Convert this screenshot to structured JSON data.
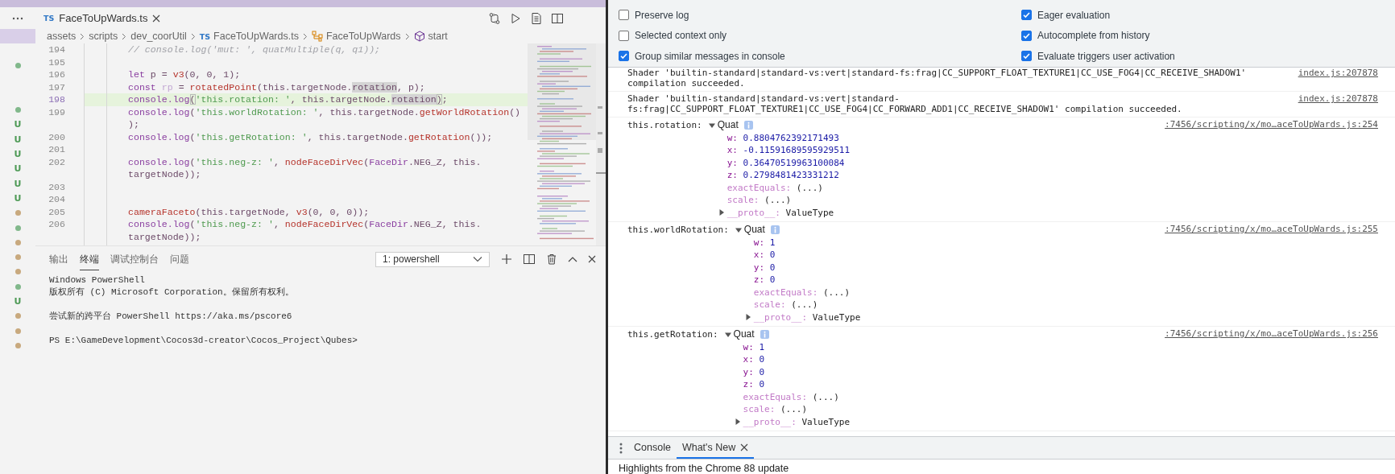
{
  "sidebar": {
    "items": [
      {
        "selected": true,
        "kind": "none"
      },
      {
        "selected": false,
        "kind": "none"
      },
      {
        "selected": false,
        "kind": "dot",
        "color": "#81b88b"
      },
      {
        "selected": false,
        "kind": "none"
      },
      {
        "selected": false,
        "kind": "none"
      },
      {
        "selected": false,
        "kind": "dot",
        "color": "#81b88b"
      },
      {
        "selected": false,
        "kind": "letter",
        "text": "U"
      },
      {
        "selected": false,
        "kind": "letter",
        "text": "U"
      },
      {
        "selected": false,
        "kind": "letter",
        "text": "U"
      },
      {
        "selected": false,
        "kind": "letter",
        "text": "U"
      },
      {
        "selected": false,
        "kind": "letter",
        "text": "U"
      },
      {
        "selected": false,
        "kind": "letter",
        "text": "U"
      },
      {
        "selected": false,
        "kind": "dot",
        "color": "#c8a97e"
      },
      {
        "selected": false,
        "kind": "dot",
        "color": "#81b88b"
      },
      {
        "selected": false,
        "kind": "dot",
        "color": "#c8a97e"
      },
      {
        "selected": false,
        "kind": "dot",
        "color": "#c8a97e"
      },
      {
        "selected": false,
        "kind": "dot",
        "color": "#c8a97e"
      },
      {
        "selected": false,
        "kind": "dot",
        "color": "#81b88b"
      },
      {
        "selected": false,
        "kind": "letter",
        "text": "U"
      },
      {
        "selected": false,
        "kind": "dot",
        "color": "#c8a97e"
      },
      {
        "selected": false,
        "kind": "dot",
        "color": "#c8a97e"
      },
      {
        "selected": false,
        "kind": "dot",
        "color": "#c8a97e"
      }
    ]
  },
  "editor": {
    "tabs": [
      {
        "badge": "TS",
        "label": "FaceToUpWards.ts",
        "selected": true
      }
    ],
    "breadcrumb": [
      {
        "kind": "folder",
        "label": "assets"
      },
      {
        "kind": "folder",
        "label": "scripts"
      },
      {
        "kind": "folder",
        "label": "dev_coorUtil"
      },
      {
        "kind": "file",
        "badge": "TS",
        "label": "FaceToUpWards.ts"
      },
      {
        "kind": "class",
        "label": "FaceToUpWards"
      },
      {
        "kind": "method",
        "label": "start"
      }
    ],
    "lines": [
      {
        "number": "194",
        "current": false,
        "tokens": [
          {
            "kind": "comment",
            "text": "// console.log('mut: ', quatMultiple(q, q1));"
          }
        ]
      },
      {
        "number": "195",
        "current": false
      },
      {
        "number": "196",
        "current": false,
        "tokens": [
          {
            "kind": "keyword",
            "text": "let"
          },
          {
            "kind": "plain",
            "text": " p = "
          },
          {
            "kind": "func",
            "text": "v3"
          },
          {
            "kind": "plain",
            "text": "(0, 0, 1);"
          }
        ]
      },
      {
        "number": "197",
        "current": false,
        "tokens": [
          {
            "kind": "keyword",
            "text": "const"
          },
          {
            "kind": "unused",
            "text": " rp"
          },
          {
            "kind": "plain",
            "text": " = "
          },
          {
            "kind": "func",
            "text": "rotatedPoint"
          },
          {
            "kind": "plain",
            "text": "(this.targetNode."
          },
          {
            "kind": "match",
            "text": "rotation"
          },
          {
            "kind": "plain",
            "text": ", p);"
          }
        ]
      },
      {
        "number": "198",
        "current": true,
        "tokens": [
          {
            "kind": "keyword",
            "text": "console.log"
          },
          {
            "kind": "bracket",
            "text": "("
          },
          {
            "kind": "string",
            "text": "'this.rotation: '"
          },
          {
            "kind": "plain",
            "text": ", this.targetNode."
          },
          {
            "kind": "match",
            "text": "rotation"
          },
          {
            "kind": "bracket",
            "text": ")"
          },
          {
            "kind": "plain",
            "text": ";"
          }
        ]
      },
      {
        "number": "199",
        "current": false,
        "tokens": [
          {
            "kind": "keyword",
            "text": "console.log"
          },
          {
            "kind": "plain",
            "text": "("
          },
          {
            "kind": "string",
            "text": "'this.worldRotation: '"
          },
          {
            "kind": "plain",
            "text": ", this.targetNode."
          },
          {
            "kind": "func",
            "text": "getWorldRotation"
          },
          {
            "kind": "plain",
            "text": "()"
          }
        ]
      },
      {
        "current": false,
        "tokens": [
          {
            "kind": "plain",
            "text": ");"
          }
        ]
      },
      {
        "number": "200",
        "current": false,
        "tokens": [
          {
            "kind": "keyword",
            "text": "console.log"
          },
          {
            "kind": "plain",
            "text": "("
          },
          {
            "kind": "string",
            "text": "'this.getRotation: '"
          },
          {
            "kind": "plain",
            "text": ", this.targetNode."
          },
          {
            "kind": "func",
            "text": "getRotation"
          },
          {
            "kind": "plain",
            "text": "());"
          }
        ]
      },
      {
        "number": "201",
        "current": false
      },
      {
        "number": "202",
        "current": false,
        "tokens": [
          {
            "kind": "keyword",
            "text": "console.log"
          },
          {
            "kind": "plain",
            "text": "("
          },
          {
            "kind": "string",
            "text": "'this.neg-z: '"
          },
          {
            "kind": "plain",
            "text": ", "
          },
          {
            "kind": "func",
            "text": "nodeFaceDirVec"
          },
          {
            "kind": "plain",
            "text": "("
          },
          {
            "kind": "keyword",
            "text": "FaceDir"
          },
          {
            "kind": "plain",
            "text": ".NEG_Z, this."
          }
        ]
      },
      {
        "current": false,
        "tokens": [
          {
            "kind": "plain",
            "text": "targetNode));"
          }
        ]
      },
      {
        "number": "203",
        "current": false
      },
      {
        "number": "204",
        "current": false
      },
      {
        "number": "205",
        "current": false,
        "tokens": [
          {
            "kind": "func",
            "text": "cameraFaceto"
          },
          {
            "kind": "plain",
            "text": "(this.targetNode, "
          },
          {
            "kind": "func",
            "text": "v3"
          },
          {
            "kind": "plain",
            "text": "(0, 0, 0));"
          }
        ]
      },
      {
        "number": "206",
        "current": false,
        "tokens": [
          {
            "kind": "keyword",
            "text": "console.log"
          },
          {
            "kind": "plain",
            "text": "("
          },
          {
            "kind": "string",
            "text": "'this.neg-z: '"
          },
          {
            "kind": "plain",
            "text": ", "
          },
          {
            "kind": "func",
            "text": "nodeFaceDirVec"
          },
          {
            "kind": "plain",
            "text": "("
          },
          {
            "kind": "keyword",
            "text": "FaceDir"
          },
          {
            "kind": "plain",
            "text": ".NEG_Z, this."
          }
        ]
      },
      {
        "current": false,
        "tokens": [
          {
            "kind": "plain",
            "text": "targetNode));"
          }
        ]
      }
    ]
  },
  "terminal": {
    "tabs": [
      {
        "label": "输出",
        "selected": false
      },
      {
        "label": "终端",
        "selected": true
      },
      {
        "label": "调试控制台",
        "selected": false
      },
      {
        "label": "问题",
        "selected": false
      }
    ],
    "dropdown": "1: powershell",
    "blocks": [
      {
        "lines": [
          "Windows PowerShell",
          "版权所有 (C) Microsoft Corporation。保留所有权利。"
        ]
      },
      {
        "lines": [
          "尝试新的跨平台 PowerShell https://aka.ms/pscore6"
        ]
      },
      {
        "lines": [
          "PS E:\\GameDevelopment\\Cocos3d-creator\\Cocos_Project\\Qubes>"
        ]
      }
    ]
  },
  "devtools": {
    "settings": [
      {
        "label": "Preserve log",
        "checked": false
      },
      {
        "label": "Eager evaluation",
        "checked": true
      },
      {
        "label": "Selected context only",
        "checked": false
      },
      {
        "label": "Autocomplete from history",
        "checked": true
      },
      {
        "label": "Group similar messages in console",
        "checked": true
      },
      {
        "label": "Evaluate triggers user activation",
        "checked": true
      }
    ],
    "messages": [
      {
        "kind": "text",
        "text": "Shader 'builtin-standard|standard-vs:vert|standard-fs:frag|CC_SUPPORT_FLOAT_TEXTURE1|CC_USE_FOG4|CC_RECEIVE_SHADOW1' compilation succeeded.",
        "source": "index.js:207878"
      },
      {
        "kind": "text",
        "text": "Shader 'builtin-standard|standard-vs:vert|standard-fs:frag|CC_SUPPORT_FLOAT_TEXTURE1|CC_USE_FOG4|CC_FORWARD_ADD1|CC_RECEIVE_SHADOW1' compilation succeeded.",
        "source": "index.js:207878"
      },
      {
        "kind": "object",
        "label": "this.rotation:",
        "type": "Quat",
        "expanded": true,
        "source": ":7456/scripting/x/mo…aceToUpWards.js:254",
        "properties": [
          {
            "kind": "own",
            "name": "w:",
            "value": "0.8804762392171493"
          },
          {
            "kind": "own",
            "name": "x:",
            "value": "-0.11591689595929511"
          },
          {
            "kind": "own",
            "name": "y:",
            "value": "0.36470519963100084"
          },
          {
            "kind": "own",
            "name": "z:",
            "value": "0.2798481423331212"
          },
          {
            "kind": "accessor",
            "name": "exactEquals:",
            "value": "(...)"
          },
          {
            "kind": "accessor",
            "name": "scale:",
            "value": "(...)"
          },
          {
            "kind": "proto",
            "name": "__proto__:",
            "value": "ValueType",
            "expanded": false
          }
        ]
      },
      {
        "kind": "object",
        "label": "this.worldRotation:",
        "type": "Quat",
        "expanded": true,
        "source": ":7456/scripting/x/mo…aceToUpWards.js:255",
        "properties": [
          {
            "kind": "own",
            "name": "w:",
            "value": "1"
          },
          {
            "kind": "own",
            "name": "x:",
            "value": "0"
          },
          {
            "kind": "own",
            "name": "y:",
            "value": "0"
          },
          {
            "kind": "own",
            "name": "z:",
            "value": "0"
          },
          {
            "kind": "accessor",
            "name": "exactEquals:",
            "value": "(...)"
          },
          {
            "kind": "accessor",
            "name": "scale:",
            "value": "(...)"
          },
          {
            "kind": "proto",
            "name": "__proto__:",
            "value": "ValueType",
            "expanded": false
          }
        ]
      },
      {
        "kind": "object",
        "label": "this.getRotation:",
        "type": "Quat",
        "expanded": true,
        "source": ":7456/scripting/x/mo…aceToUpWards.js:256",
        "properties": [
          {
            "kind": "own",
            "name": "w:",
            "value": "1"
          },
          {
            "kind": "own",
            "name": "x:",
            "value": "0"
          },
          {
            "kind": "own",
            "name": "y:",
            "value": "0"
          },
          {
            "kind": "own",
            "name": "z:",
            "value": "0"
          },
          {
            "kind": "accessor",
            "name": "exactEquals:",
            "value": "(...)"
          },
          {
            "kind": "accessor",
            "name": "scale:",
            "value": "(...)"
          },
          {
            "kind": "proto",
            "name": "__proto__:",
            "value": "ValueType",
            "expanded": false
          }
        ]
      }
    ],
    "drawer": {
      "tabs": [
        {
          "label": "Console",
          "selected": false,
          "closable": false
        },
        {
          "label": "What's New",
          "selected": true,
          "closable": true
        }
      ],
      "content": "Highlights from the Chrome 88 update"
    }
  }
}
